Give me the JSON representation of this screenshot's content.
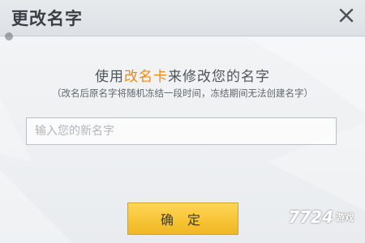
{
  "dialog": {
    "title": "更改名字",
    "close_icon": "close-icon"
  },
  "message": {
    "prefix": "使用",
    "highlight": "改名卡",
    "suffix": "来修改您的名字",
    "note": "（改名后原名字将随机冻结一段时间，冻结期间无法创建名字）"
  },
  "input": {
    "placeholder": "输入您的新名字",
    "value": ""
  },
  "confirm_button": {
    "label": "确 定"
  },
  "watermark": {
    "number": "7724",
    "text": "游戏"
  },
  "colors": {
    "highlight": "#f08a14",
    "button": "#f6c333",
    "title": "#3a3f45"
  }
}
